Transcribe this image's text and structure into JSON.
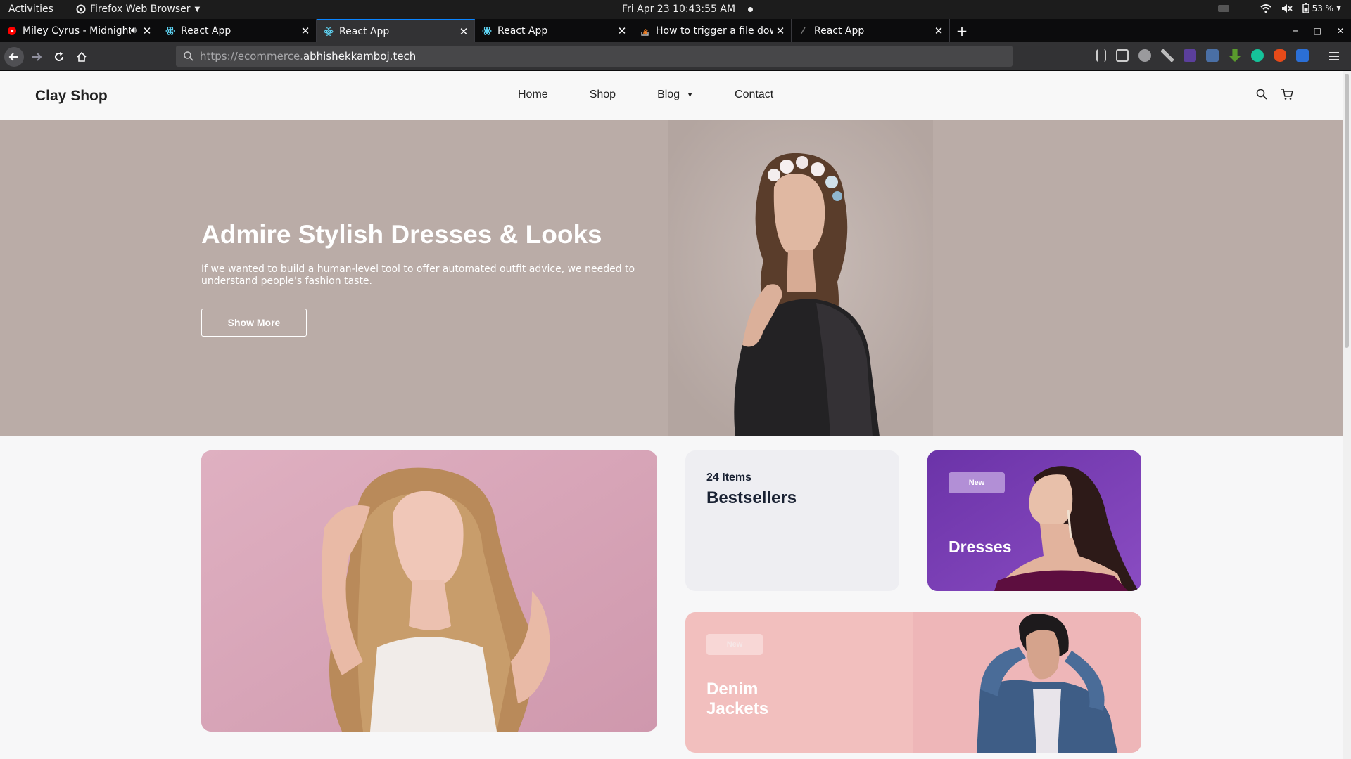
{
  "system_bar": {
    "activities": "Activities",
    "app_name": "Firefox Web Browser",
    "datetime": "Fri Apr 23  10:43:55 AM",
    "battery": "53 %"
  },
  "browser": {
    "tabs": [
      {
        "title": "Miley Cyrus - Midnight Sky",
        "favicon": "youtube-icon",
        "active": false,
        "playing_audio": true
      },
      {
        "title": "React App",
        "favicon": "react-icon",
        "active": false
      },
      {
        "title": "React App",
        "favicon": "react-icon",
        "active": true
      },
      {
        "title": "React App",
        "favicon": "react-icon",
        "active": false
      },
      {
        "title": "How to trigger a file download",
        "favicon": "stackoverflow-icon",
        "active": false
      },
      {
        "title": "React App",
        "favicon": "react-icon",
        "active": false
      }
    ],
    "url_protocol": "https://ecommerce.",
    "url_domain": "abhishekkamboj.tech",
    "accent": "#0a84ff"
  },
  "site": {
    "logo": "Clay Shop",
    "nav": [
      {
        "label": "Home"
      },
      {
        "label": "Shop"
      },
      {
        "label": "Blog",
        "has_dropdown": true
      },
      {
        "label": "Contact"
      }
    ],
    "hero": {
      "title": "Admire Stylish Dresses & Looks",
      "text": "If we wanted to build a human-level tool to offer automated outfit advice, we needed to understand people's fashion taste.",
      "button": "Show More",
      "background": "#baaca7"
    },
    "categories": {
      "bestsellers": {
        "count": "24 Items",
        "name": "Bestsellers"
      },
      "dresses": {
        "badge": "New",
        "name": "Dresses",
        "color": "#7a3fb6"
      },
      "denim": {
        "badge": "New",
        "name": "Denim Jackets",
        "color": "#f2bfbe"
      }
    }
  }
}
